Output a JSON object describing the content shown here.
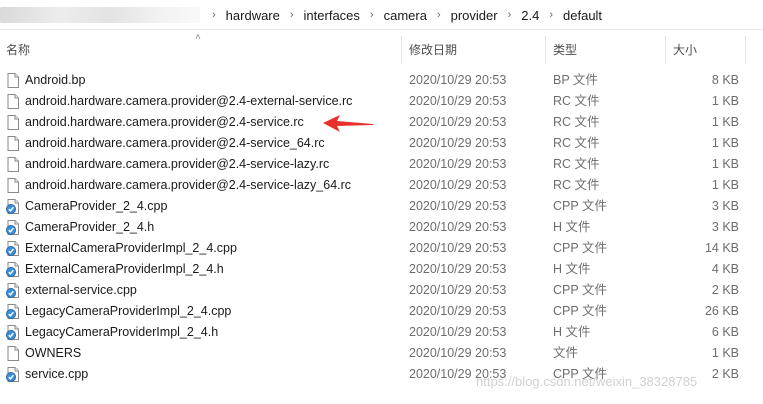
{
  "breadcrumb": [
    "hardware",
    "interfaces",
    "camera",
    "provider",
    "2.4",
    "default"
  ],
  "columns": {
    "name": "名称",
    "date": "修改日期",
    "type": "类型",
    "size": "大小"
  },
  "files": [
    {
      "name": "Android.bp",
      "date": "2020/10/29 20:53",
      "type": "BP 文件",
      "size": "8 KB",
      "icon": "blank-file-icon"
    },
    {
      "name": "android.hardware.camera.provider@2.4-external-service.rc",
      "date": "2020/10/29 20:53",
      "type": "RC 文件",
      "size": "1 KB",
      "icon": "blank-file-icon"
    },
    {
      "name": "android.hardware.camera.provider@2.4-service.rc",
      "date": "2020/10/29 20:53",
      "type": "RC 文件",
      "size": "1 KB",
      "icon": "blank-file-icon"
    },
    {
      "name": "android.hardware.camera.provider@2.4-service_64.rc",
      "date": "2020/10/29 20:53",
      "type": "RC 文件",
      "size": "1 KB",
      "icon": "blank-file-icon"
    },
    {
      "name": "android.hardware.camera.provider@2.4-service-lazy.rc",
      "date": "2020/10/29 20:53",
      "type": "RC 文件",
      "size": "1 KB",
      "icon": "blank-file-icon"
    },
    {
      "name": "android.hardware.camera.provider@2.4-service-lazy_64.rc",
      "date": "2020/10/29 20:53",
      "type": "RC 文件",
      "size": "1 KB",
      "icon": "blank-file-icon"
    },
    {
      "name": "CameraProvider_2_4.cpp",
      "date": "2020/10/29 20:53",
      "type": "CPP 文件",
      "size": "3 KB",
      "icon": "source-file-icon"
    },
    {
      "name": "CameraProvider_2_4.h",
      "date": "2020/10/29 20:53",
      "type": "H 文件",
      "size": "3 KB",
      "icon": "source-file-icon"
    },
    {
      "name": "ExternalCameraProviderImpl_2_4.cpp",
      "date": "2020/10/29 20:53",
      "type": "CPP 文件",
      "size": "14 KB",
      "icon": "source-file-icon"
    },
    {
      "name": "ExternalCameraProviderImpl_2_4.h",
      "date": "2020/10/29 20:53",
      "type": "H 文件",
      "size": "4 KB",
      "icon": "source-file-icon"
    },
    {
      "name": "external-service.cpp",
      "date": "2020/10/29 20:53",
      "type": "CPP 文件",
      "size": "2 KB",
      "icon": "source-file-icon"
    },
    {
      "name": "LegacyCameraProviderImpl_2_4.cpp",
      "date": "2020/10/29 20:53",
      "type": "CPP 文件",
      "size": "26 KB",
      "icon": "source-file-icon"
    },
    {
      "name": "LegacyCameraProviderImpl_2_4.h",
      "date": "2020/10/29 20:53",
      "type": "H 文件",
      "size": "6 KB",
      "icon": "source-file-icon"
    },
    {
      "name": "OWNERS",
      "date": "2020/10/29 20:53",
      "type": "文件",
      "size": "1 KB",
      "icon": "blank-file-icon"
    },
    {
      "name": "service.cpp",
      "date": "2020/10/29 20:53",
      "type": "CPP 文件",
      "size": "2 KB",
      "icon": "source-file-icon"
    }
  ],
  "annotation": {
    "arrow_color": "#e8312a",
    "target_row": 2
  },
  "watermark": "https://blog.csdn.net/weixin_38328785"
}
